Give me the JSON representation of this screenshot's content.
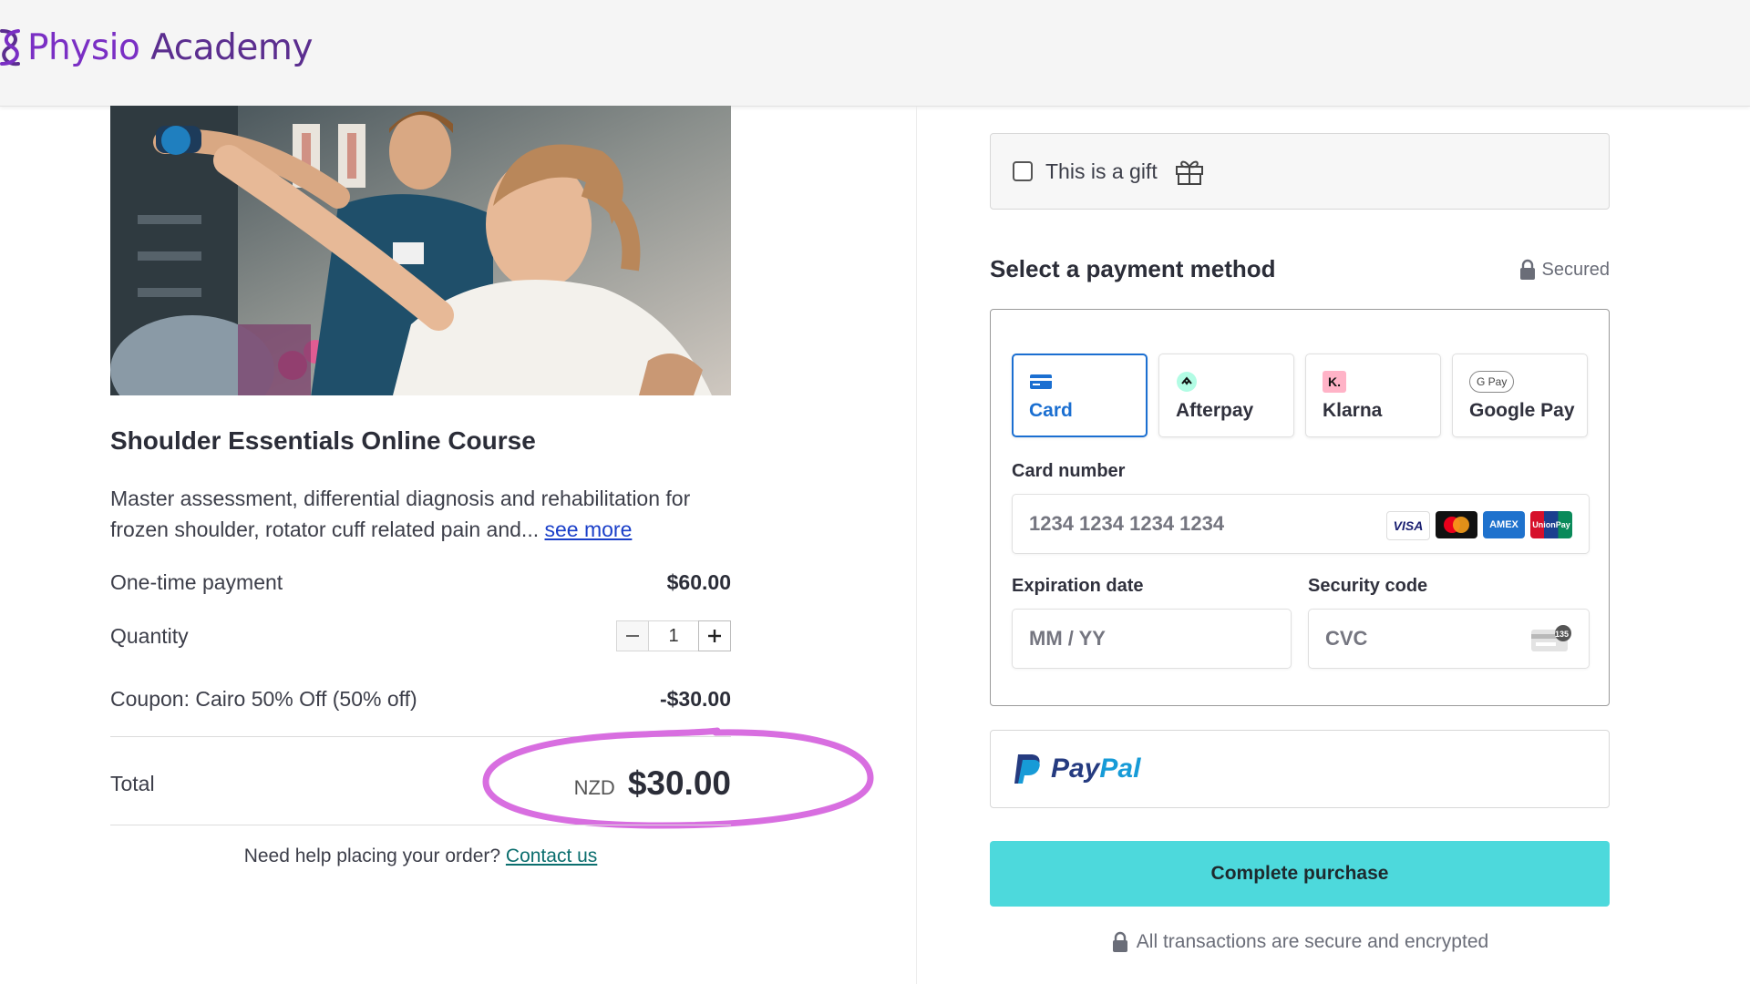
{
  "header": {
    "logo_word1": "Physio",
    "logo_word2": "Academy"
  },
  "product": {
    "title": "Shoulder Essentials Online Course",
    "description": "Master assessment, differential diagnosis and rehabilitation for frozen shoulder, rotator cuff related pain and...",
    "see_more": "see more"
  },
  "summary": {
    "payment_label": "One-time payment",
    "payment_value": "$60.00",
    "quantity_label": "Quantity",
    "quantity_value": "1",
    "coupon_label": "Coupon: Cairo 50% Off (50% off)",
    "coupon_value": "-$30.00",
    "total_label": "Total",
    "total_currency": "NZD",
    "total_value": "$30.00"
  },
  "help": {
    "text": "Need help placing your order?",
    "link": "Contact us"
  },
  "gift": {
    "label": "This is a gift"
  },
  "payment": {
    "title": "Select a payment method",
    "secured": "Secured",
    "tabs": [
      {
        "label": "Card",
        "icon": "card-icon"
      },
      {
        "label": "Afterpay",
        "icon": "afterpay-icon"
      },
      {
        "label": "Klarna",
        "icon": "klarna-icon"
      },
      {
        "label": "Google Pay",
        "icon": "google-pay-icon"
      }
    ],
    "card_number_label": "Card number",
    "card_number_placeholder": "1234 1234 1234 1234",
    "expiry_label": "Expiration date",
    "expiry_placeholder": "MM / YY",
    "cvc_label": "Security code",
    "cvc_placeholder": "CVC",
    "brands": [
      "VISA",
      "Mastercard",
      "AMEX",
      "UnionPay"
    ],
    "klarna_badge": "K.",
    "gpay_badge": "G Pay",
    "cvc_badge": "135"
  },
  "paypal": {
    "word1": "Pay",
    "word2": "Pal"
  },
  "actions": {
    "complete": "Complete purchase",
    "secure_note": "All transactions are secure and encrypted"
  },
  "colors": {
    "accent": "#1b6fd1",
    "button": "#4dd9dc",
    "annotation": "#d86ee0",
    "brand": "#5b2e8f"
  }
}
